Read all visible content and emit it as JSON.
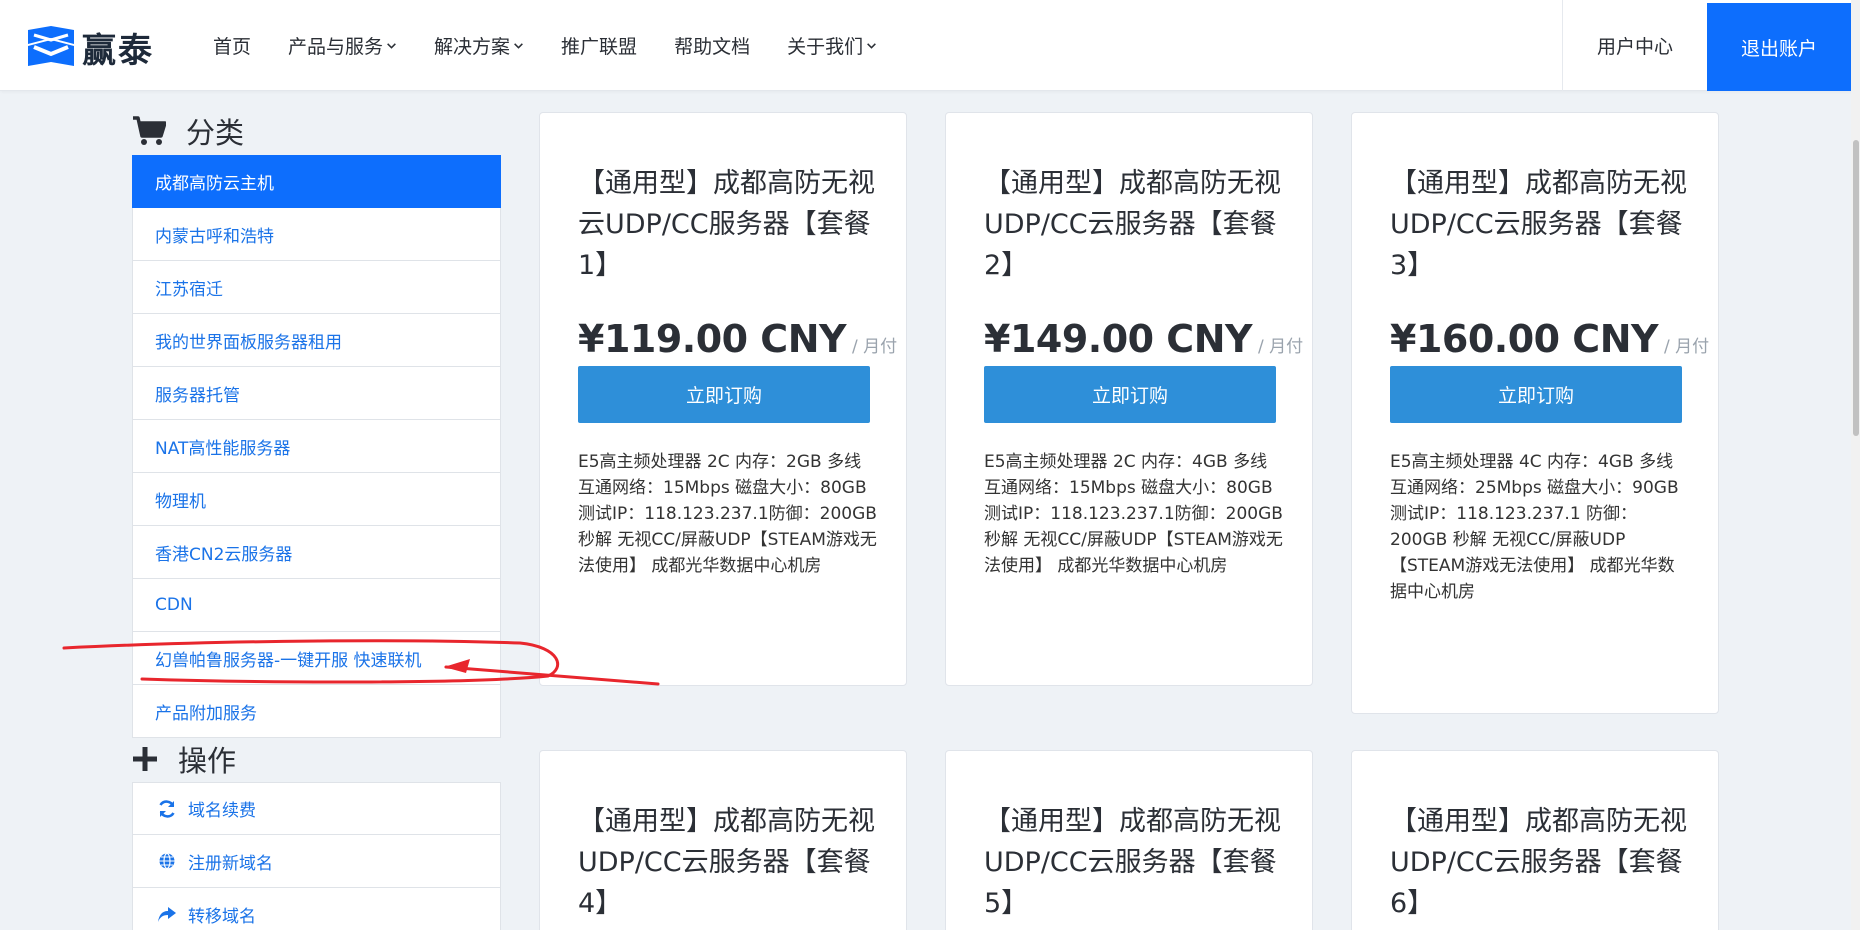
{
  "header": {
    "logo_text": "赢泰",
    "nav": [
      {
        "label": "首页",
        "has_dropdown": false
      },
      {
        "label": "产品与服务",
        "has_dropdown": true
      },
      {
        "label": "解决方案",
        "has_dropdown": true
      },
      {
        "label": "推广联盟",
        "has_dropdown": false
      },
      {
        "label": "帮助文档",
        "has_dropdown": false
      },
      {
        "label": "关于我们",
        "has_dropdown": true
      }
    ],
    "user_center": "用户中心",
    "logout": "退出账户",
    "brand_color": "#0d6efd"
  },
  "sidebar": {
    "categories_title": "分类",
    "categories": [
      {
        "label": "成都高防云主机",
        "active": true
      },
      {
        "label": "内蒙古呼和浩特",
        "active": false
      },
      {
        "label": "江苏宿迁",
        "active": false
      },
      {
        "label": "我的世界面板服务器租用",
        "active": false
      },
      {
        "label": "服务器托管",
        "active": false
      },
      {
        "label": "NAT高性能服务器",
        "active": false
      },
      {
        "label": "物理机",
        "active": false
      },
      {
        "label": "香港CN2云服务器",
        "active": false
      },
      {
        "label": "CDN",
        "active": false
      },
      {
        "label": "幻兽帕鲁服务器-一键开服 快速联机",
        "active": false
      },
      {
        "label": "产品附加服务",
        "active": false
      }
    ],
    "actions_title": "操作",
    "actions": [
      {
        "label": "域名续费",
        "icon": "refresh-icon"
      },
      {
        "label": "注册新域名",
        "icon": "globe-icon"
      },
      {
        "label": "转移域名",
        "icon": "share-icon"
      }
    ]
  },
  "products": [
    {
      "title": "【通用型】成都高防无视云UDP/CC服务器【套餐1】",
      "price": "¥119.00 CNY",
      "period": "/ 月付",
      "button": "立即订购",
      "description": "E5高主频处理器 2C 内存：2GB 多线互通网络：15Mbps 磁盘大小：80GB 测试IP：118.123.237.1防御：200GB秒解 无视CC/屏蔽UDP【STEAM游戏无法使用】 成都光华数据中心机房"
    },
    {
      "title": "【通用型】成都高防无视UDP/CC云服务器【套餐2】",
      "price": "¥149.00 CNY",
      "period": "/ 月付",
      "button": "立即订购",
      "description": "E5高主频处理器 2C 内存：4GB 多线互通网络：15Mbps 磁盘大小：80GB 测试IP：118.123.237.1防御：200GB秒解 无视CC/屏蔽UDP【STEAM游戏无法使用】 成都光华数据中心机房"
    },
    {
      "title": "【通用型】成都高防无视UDP/CC云服务器【套餐3】",
      "price": "¥160.00 CNY",
      "period": "/ 月付",
      "button": "立即订购",
      "description": "E5高主频处理器 4C 内存：4GB 多线互通网络：25Mbps 磁盘大小：90GB 测试IP：118.123.237.1 防御：200GB 秒解 无视CC/屏蔽UDP【STEAM游戏无法使用】 成都光华数据中心机房"
    },
    {
      "title": "【通用型】成都高防无视UDP/CC云服务器【套餐4】"
    },
    {
      "title": "【通用型】成都高防无视UDP/CC云服务器【套餐5】"
    },
    {
      "title": "【通用型】成都高防无视UDP/CC云服务器【套餐6】"
    }
  ],
  "colors": {
    "order_button": "#2e8fd9",
    "link": "#1a73e8",
    "annotation": "#e8262d"
  }
}
